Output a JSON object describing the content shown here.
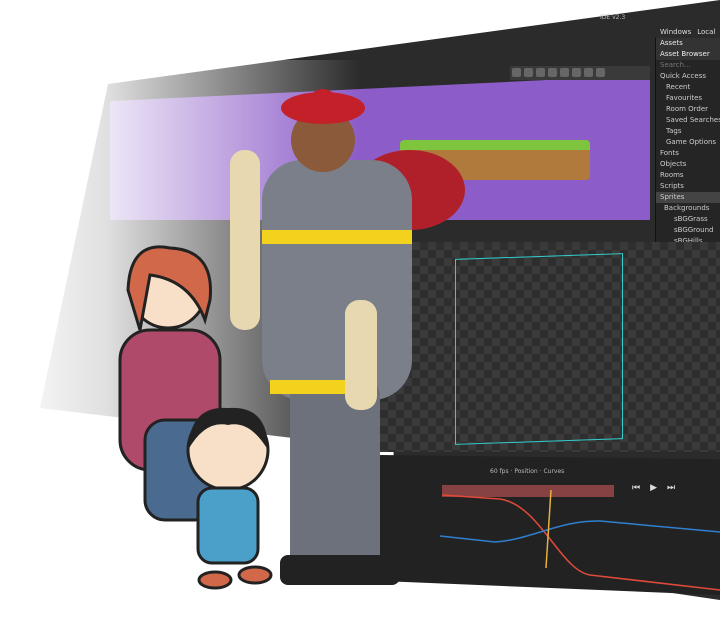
{
  "ide": {
    "title": "IDE v2.3",
    "menu": [
      "Windows",
      "Local"
    ]
  },
  "assets": {
    "tab": "Assets",
    "panel": "Asset Browser",
    "search_placeholder": "Search...",
    "items": [
      "Quick Access",
      "Recent",
      "Favourites",
      "Room Order",
      "Saved Searches",
      "Tags",
      "Game Options",
      "Fonts",
      "Objects",
      "Rooms",
      "Scripts",
      "Sprites",
      "Backgrounds",
      "sBGGrass",
      "sBGGround",
      "sBGHills"
    ]
  },
  "timeline": {
    "fps_value": "60",
    "fps_label": "fps",
    "track": "Position",
    "curves_label": "Curves"
  },
  "colors": {
    "accent": "#8c5cc8",
    "curve_red": "#e04a3a",
    "curve_blue": "#2f7fd0",
    "playhead": "#e8b040"
  }
}
